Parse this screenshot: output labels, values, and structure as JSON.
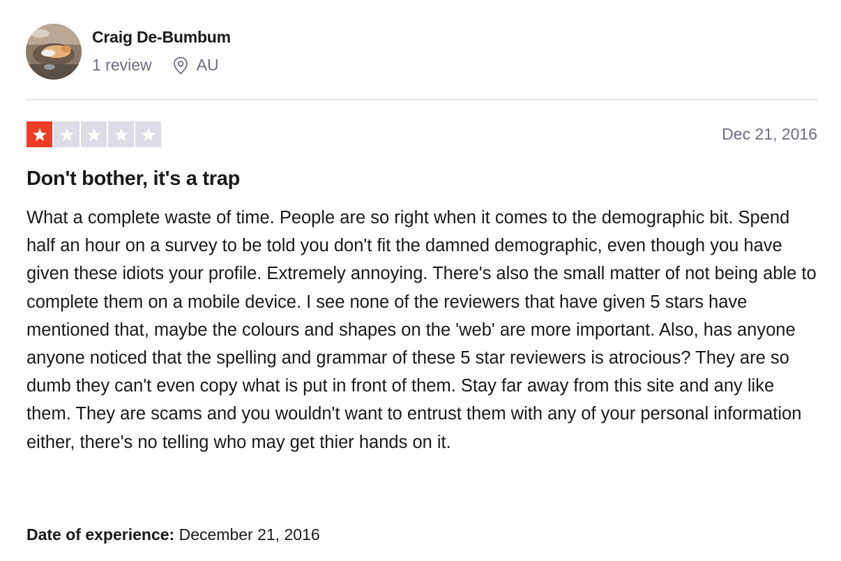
{
  "consumer": {
    "name": "Craig De-Bumbum",
    "review_count": "1 review",
    "location": "AU",
    "location_icon": "location-pin-icon",
    "avatar_icon": "avatar-photo"
  },
  "review": {
    "rating": 1,
    "rating_max": 5,
    "star_color_filled": "#ee3d24",
    "star_color_empty": "#dcdce6",
    "date": "Dec 21, 2016",
    "title": "Don't bother, it's a trap",
    "body": "What a complete waste of time. People are so right when it comes to the demographic bit. Spend half an hour on a survey to be told you don't fit the damned demographic, even though you have given these idiots your profile. Extremely annoying. There's also the small matter of not being able to complete them on a mobile device. I see none of the reviewers that have given 5 stars have mentioned that, maybe the colours and shapes on the 'web' are more important. Also, has anyone anyone noticed that the spelling and grammar of these 5 star reviewers is atrocious? They are so dumb they can't even copy what is put in front of them. Stay far away from this site and any like them. They are scams and you wouldn't want to entrust them with any of your personal information either, there's no telling who may get thier hands on it.",
    "experience_label": "Date of experience:",
    "experience_date": "December 21, 2016"
  }
}
